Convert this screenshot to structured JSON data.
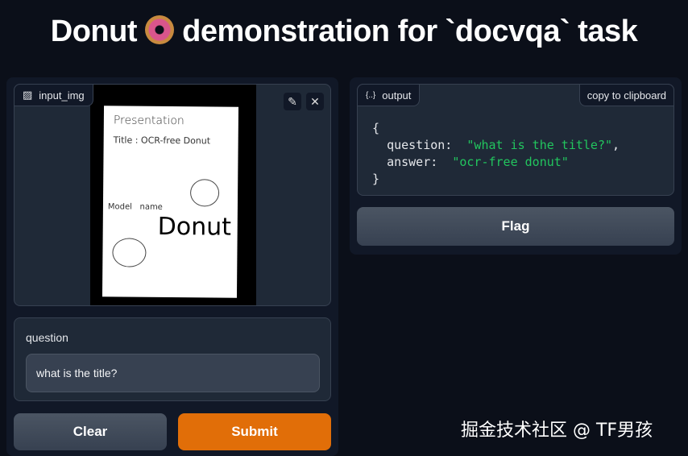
{
  "title_before": "Donut",
  "title_after": "demonstration for `docvqa` task",
  "input": {
    "label": "input_img",
    "paper_lines": [
      "Presentation",
      "Title : OCR-free Donut",
      "Model   name",
      "Donut"
    ]
  },
  "question": {
    "label": "question",
    "value": "what is the title?"
  },
  "buttons": {
    "clear": "Clear",
    "submit": "Submit",
    "flag": "Flag"
  },
  "output": {
    "label": "output",
    "copy": "copy to clipboard",
    "open": "{",
    "close": "}",
    "question_key": "question:",
    "question_val": "\"what is the title?\"",
    "answer_key": "answer:",
    "answer_val": "\"ocr-free donut\""
  },
  "watermark": "掘金技术社区 @ TF男孩",
  "colors": {
    "submit": "#e16e08",
    "bg": "#0b0f19"
  }
}
